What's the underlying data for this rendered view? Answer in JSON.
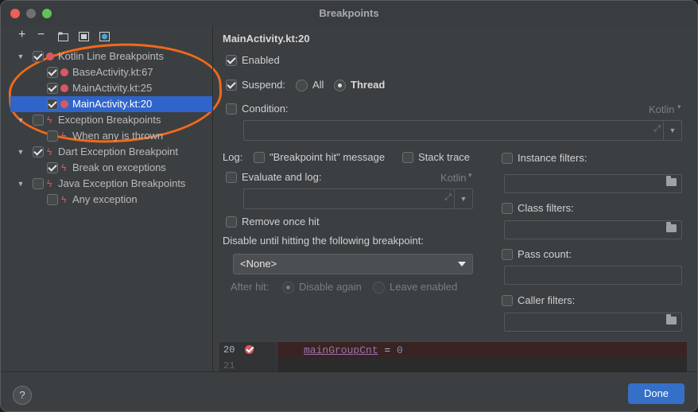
{
  "window": {
    "title": "Breakpoints"
  },
  "toolbar": {
    "add": "+",
    "remove": "−"
  },
  "tree": [
    {
      "label": "Kotlin Line Breakpoints",
      "checked": true,
      "icon": "breakpoint-dot"
    },
    {
      "label": "BaseActivity.kt:67",
      "checked": true,
      "icon": "breakpoint-dot"
    },
    {
      "label": "MainActivity.kt:25",
      "checked": true,
      "icon": "breakpoint-dot"
    },
    {
      "label": "MainActivity.kt:20",
      "checked": true,
      "icon": "breakpoint-check",
      "selected": true
    },
    {
      "label": "Exception Breakpoints",
      "checked": false,
      "icon": "lightning"
    },
    {
      "label": "When any is thrown",
      "checked": false,
      "icon": "lightning"
    },
    {
      "label": "Dart Exception Breakpoint",
      "checked": true,
      "icon": "lightning"
    },
    {
      "label": "Break on exceptions",
      "checked": true,
      "icon": "lightning"
    },
    {
      "label": "Java Exception Breakpoints",
      "checked": false,
      "icon": "lightning"
    },
    {
      "label": "Any exception",
      "checked": false,
      "icon": "lightning"
    }
  ],
  "details": {
    "heading": "MainActivity.kt:20",
    "enabled": "Enabled",
    "suspend": "Suspend:",
    "suspend_all": "All",
    "suspend_thread": "Thread",
    "condition": "Condition:",
    "condition_lang": "Kotlin",
    "log": "Log:",
    "log_message": "\"Breakpoint hit\" message",
    "stack_trace": "Stack trace",
    "evaluate_log": "Evaluate and log:",
    "evaluate_lang": "Kotlin",
    "remove_once": "Remove once hit",
    "disable_until": "Disable until hitting the following breakpoint:",
    "disable_select": "<None>",
    "after_hit": "After hit:",
    "disable_again": "Disable again",
    "leave_enabled": "Leave enabled",
    "instance_filters": "Instance filters:",
    "class_filters": "Class filters:",
    "pass_count": "Pass count:",
    "caller_filters": "Caller filters:"
  },
  "editor": {
    "line1": "20",
    "line2": "21",
    "code_var": "mainGroupCnt",
    "code_op": " = ",
    "code_num": "0"
  },
  "footer": {
    "help": "?",
    "done": "Done"
  },
  "colors": {
    "accent": "#3470c8",
    "selection": "#2f65ca",
    "breakpoint": "#db5860",
    "annotation": "#f06a1a"
  }
}
